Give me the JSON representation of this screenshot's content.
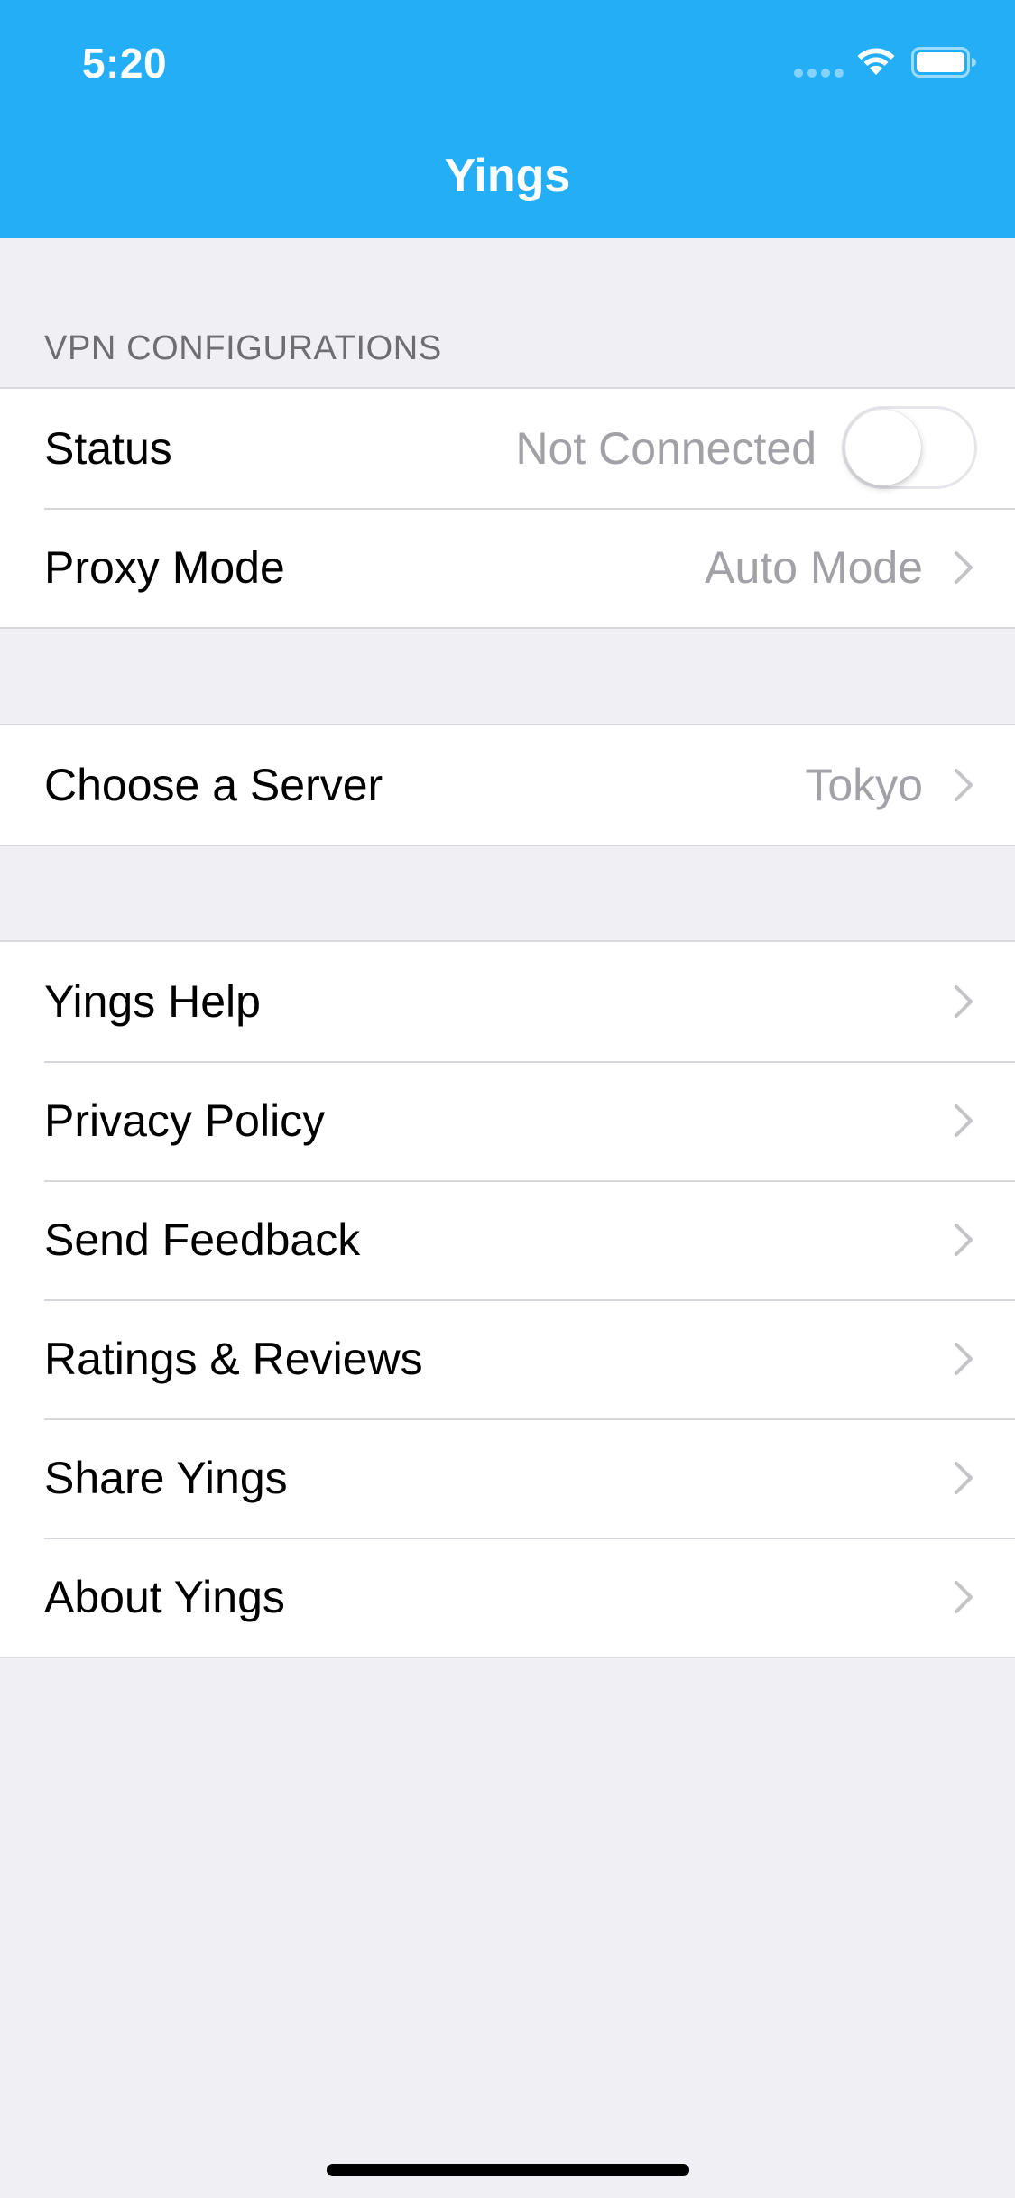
{
  "status_bar": {
    "time": "5:20"
  },
  "nav": {
    "title": "Yings"
  },
  "vpn_section": {
    "header": "VPN CONFIGURATIONS",
    "status": {
      "label": "Status",
      "value": "Not Connected",
      "toggle_on": false
    },
    "proxy_mode": {
      "label": "Proxy Mode",
      "value": "Auto Mode"
    }
  },
  "server_section": {
    "choose_server": {
      "label": "Choose a Server",
      "value": "Tokyo"
    }
  },
  "info_section": {
    "items": [
      {
        "label": "Yings Help"
      },
      {
        "label": "Privacy Policy"
      },
      {
        "label": "Send Feedback"
      },
      {
        "label": "Ratings & Reviews"
      },
      {
        "label": "Share Yings"
      },
      {
        "label": "About Yings"
      }
    ]
  },
  "colors": {
    "header_bg": "#24aef5",
    "page_bg": "#efeff4",
    "secondary_text": "#a1a1a6",
    "section_header_text": "#6d6d72",
    "chevron": "#c4c4c7"
  },
  "icons": {
    "wifi": "wifi-icon",
    "battery": "battery-icon",
    "chevron": "chevron-right-icon"
  }
}
